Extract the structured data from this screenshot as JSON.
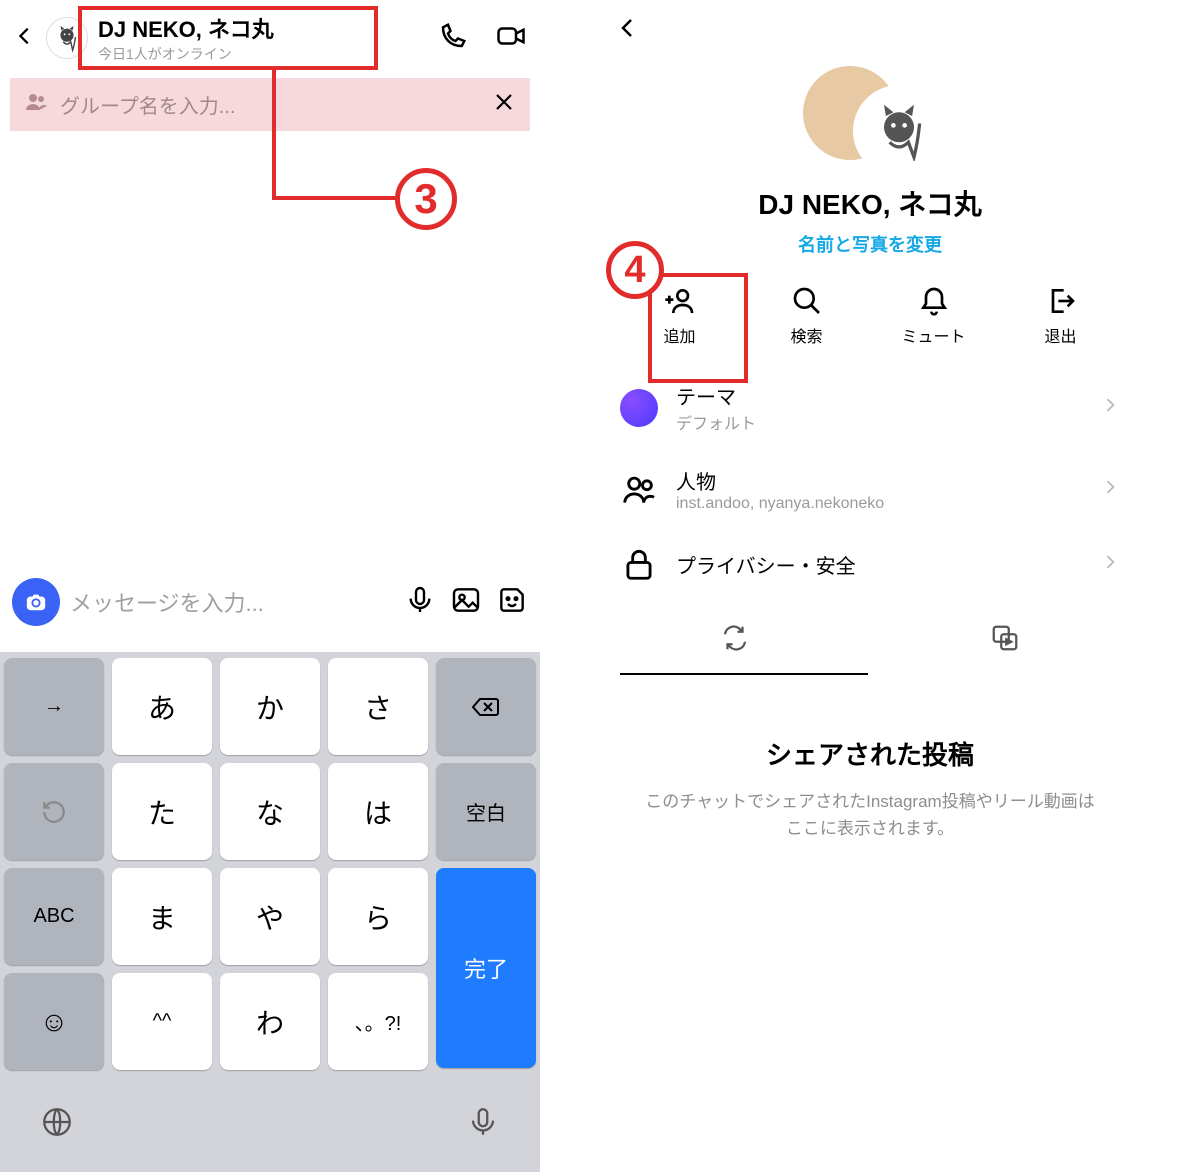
{
  "annotations": {
    "step3": "3",
    "step4": "4"
  },
  "left": {
    "header": {
      "title": "DJ NEKO, ネコ丸",
      "subtitle": "今日1人がオンライン"
    },
    "group_name_placeholder": "グループ名を入力...",
    "message_placeholder": "メッセージを入力...",
    "keyboard": {
      "rows": [
        [
          "→",
          "あ",
          "か",
          "さ",
          "⌫"
        ],
        [
          "↺",
          "た",
          "な",
          "は",
          "空白"
        ],
        [
          "ABC",
          "ま",
          "や",
          "ら",
          "完了"
        ],
        [
          "☺",
          "^^",
          "わ",
          "、。?!",
          ""
        ]
      ],
      "space_label": "空白",
      "done_label": "完了",
      "abc_label": "ABC"
    }
  },
  "right": {
    "title": "DJ NEKO, ネコ丸",
    "change_link": "名前と写真を変更",
    "actions": {
      "add": "追加",
      "search": "検索",
      "mute": "ミュート",
      "leave": "退出"
    },
    "settings": {
      "theme_label": "テーマ",
      "theme_value": "デフォルト",
      "people_label": "人物",
      "people_value": "inst.andoo, nyanya.nekoneko",
      "privacy_label": "プライバシー・安全"
    },
    "shared_title": "シェアされた投稿",
    "shared_desc": "このチャットでシェアされたInstagram投稿やリール動画はここに表示されます。"
  }
}
